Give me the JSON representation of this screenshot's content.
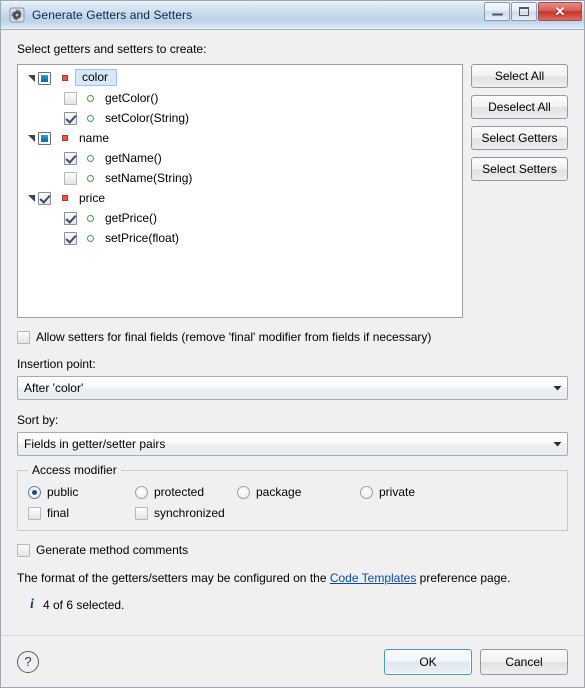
{
  "window": {
    "title": "Generate Getters and Setters",
    "icon": "eclipse-gear-icon",
    "minimize_label": "Minimize",
    "maximize_label": "Maximize",
    "close_label": "✕"
  },
  "main": {
    "tree_label": "Select getters and setters to create:",
    "tree": [
      {
        "label": "color",
        "kind": "field",
        "check_state": "partial",
        "selected": true,
        "expanded": true,
        "children": [
          {
            "label": "getColor()",
            "kind": "method",
            "check_state": "unchecked"
          },
          {
            "label": "setColor(String)",
            "kind": "method",
            "check_state": "checked"
          }
        ]
      },
      {
        "label": "name",
        "kind": "field",
        "check_state": "partial",
        "selected": false,
        "expanded": true,
        "children": [
          {
            "label": "getName()",
            "kind": "method",
            "check_state": "checked"
          },
          {
            "label": "setName(String)",
            "kind": "method",
            "check_state": "unchecked"
          }
        ]
      },
      {
        "label": "price",
        "kind": "field",
        "check_state": "checked",
        "selected": false,
        "expanded": true,
        "children": [
          {
            "label": "getPrice()",
            "kind": "method",
            "check_state": "checked"
          },
          {
            "label": "setPrice(float)",
            "kind": "method",
            "check_state": "checked"
          }
        ]
      }
    ],
    "side_buttons": [
      {
        "label": "Select All"
      },
      {
        "label": "Deselect All"
      },
      {
        "label": "Select Getters"
      },
      {
        "label": "Select Setters"
      }
    ],
    "allow_final_setters": {
      "label": "Allow setters for final fields (remove 'final' modifier from fields if necessary)",
      "checked": false
    },
    "insertion_point": {
      "label": "Insertion point:",
      "value": "After 'color'"
    },
    "sort_by": {
      "label": "Sort by:",
      "value": "Fields in getter/setter pairs"
    },
    "access_modifier": {
      "title": "Access modifier",
      "radios": [
        {
          "label": "public",
          "selected": true
        },
        {
          "label": "protected",
          "selected": false
        },
        {
          "label": "package",
          "selected": false
        },
        {
          "label": "private",
          "selected": false
        }
      ],
      "checks": [
        {
          "label": "final",
          "checked": false
        },
        {
          "label": "synchronized",
          "checked": false
        }
      ]
    },
    "generate_comments": {
      "label": "Generate method comments",
      "checked": false
    },
    "hint": {
      "before": "The format of the getters/setters may be configured on the ",
      "link": "Code Templates",
      "after": " preference page."
    },
    "status": {
      "icon": "info-icon",
      "glyph": "i",
      "text": "4 of 6 selected."
    }
  },
  "footer": {
    "help_label": "?",
    "ok_label": "OK",
    "cancel_label": "Cancel"
  },
  "colors": {
    "titlebar_accent": "#c5d9ec",
    "close_button": "#c4352c",
    "link": "#0c4a9e",
    "field_icon": "#e8574e",
    "method_icon": "#4f9a4f",
    "checkbox_fill": "#1d7fb5",
    "selection_highlight": "#d8e8f8",
    "default_button_border": "#4a9bc4"
  }
}
